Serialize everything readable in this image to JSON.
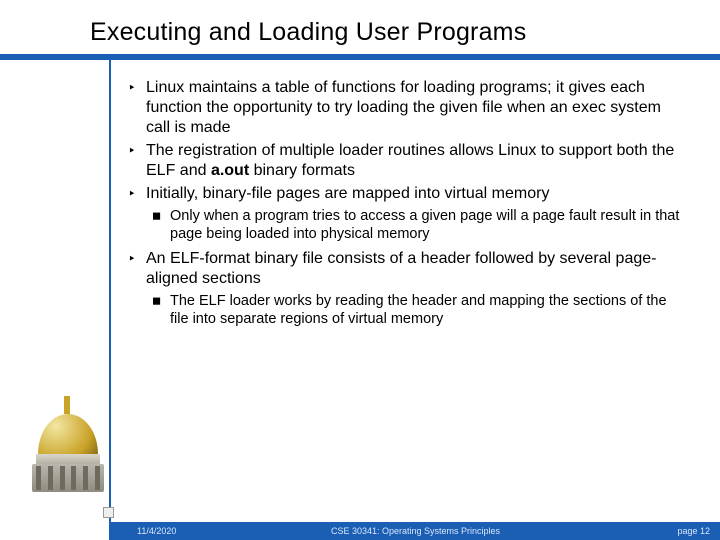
{
  "title": "Executing and Loading User Programs",
  "bullets": [
    {
      "level": 1,
      "text": "Linux maintains a table of functions for loading programs; it gives each function the opportunity to try loading the given file when an exec system call is made"
    },
    {
      "level": 1,
      "text_html": "The registration of multiple loader routines allows Linux to support both the ELF and <b>a.out</b> binary formats"
    },
    {
      "level": 1,
      "text": "Initially, binary-file pages are mapped into virtual memory"
    },
    {
      "level": 2,
      "text": "Only when a program tries to access a given page will a page fault result in that page being loaded into physical memory"
    },
    {
      "level": 1,
      "text": "An ELF-format binary file consists of a header followed by several page-aligned sections"
    },
    {
      "level": 2,
      "text": "The ELF loader works by reading the header and mapping the sections of the file into separate regions of virtual memory"
    }
  ],
  "footer": {
    "date": "11/4/2020",
    "course": "CSE 30341: Operating Systems Principles",
    "page": "page 12"
  },
  "glyphs": {
    "level1": "‣",
    "level2": "◼"
  }
}
